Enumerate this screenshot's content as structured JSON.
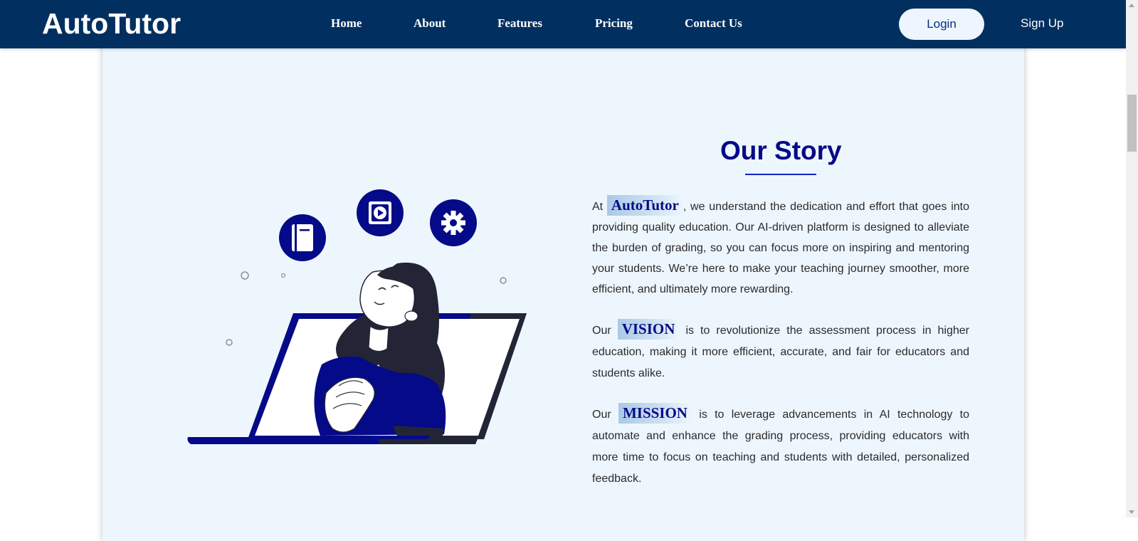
{
  "navbar": {
    "brand": "AutoTutor",
    "links": [
      "Home",
      "About",
      "Features",
      "Pricing",
      "Contact Us"
    ],
    "login_label": "Login",
    "signup_label": "Sign Up"
  },
  "story": {
    "title": "Our Story",
    "p1_prefix": "At",
    "p1_highlight": "AutoTutor",
    "p1_text": ", we understand the dedication and effort that goes into providing quality education. Our AI-driven platform is designed to alleviate the burden of grading, so you can focus more on inspiring and mentoring your students. We’re here to make your teaching journey smoother, more efficient, and ultimately more rewarding.",
    "p2_prefix": "Our",
    "p2_highlight": "VISION",
    "p2_text": " is to revolutionize the assessment process in higher education, making it more efficient, accurate, and fair for educators and students alike.",
    "p3_prefix": "Our",
    "p3_highlight": "MISSION",
    "p3_text": " is to leverage advancements in AI technology to automate and enhance the grading process, providing educators with more time to focus on teaching and students with detailed, personalized feedback."
  },
  "colors": {
    "navbar_bg": "#002f60",
    "accent": "#040a88",
    "card_bg": "#eef6fd",
    "illustration_dark": "#232536"
  },
  "icons": [
    "book-icon",
    "play-video-icon",
    "gear-icon"
  ]
}
